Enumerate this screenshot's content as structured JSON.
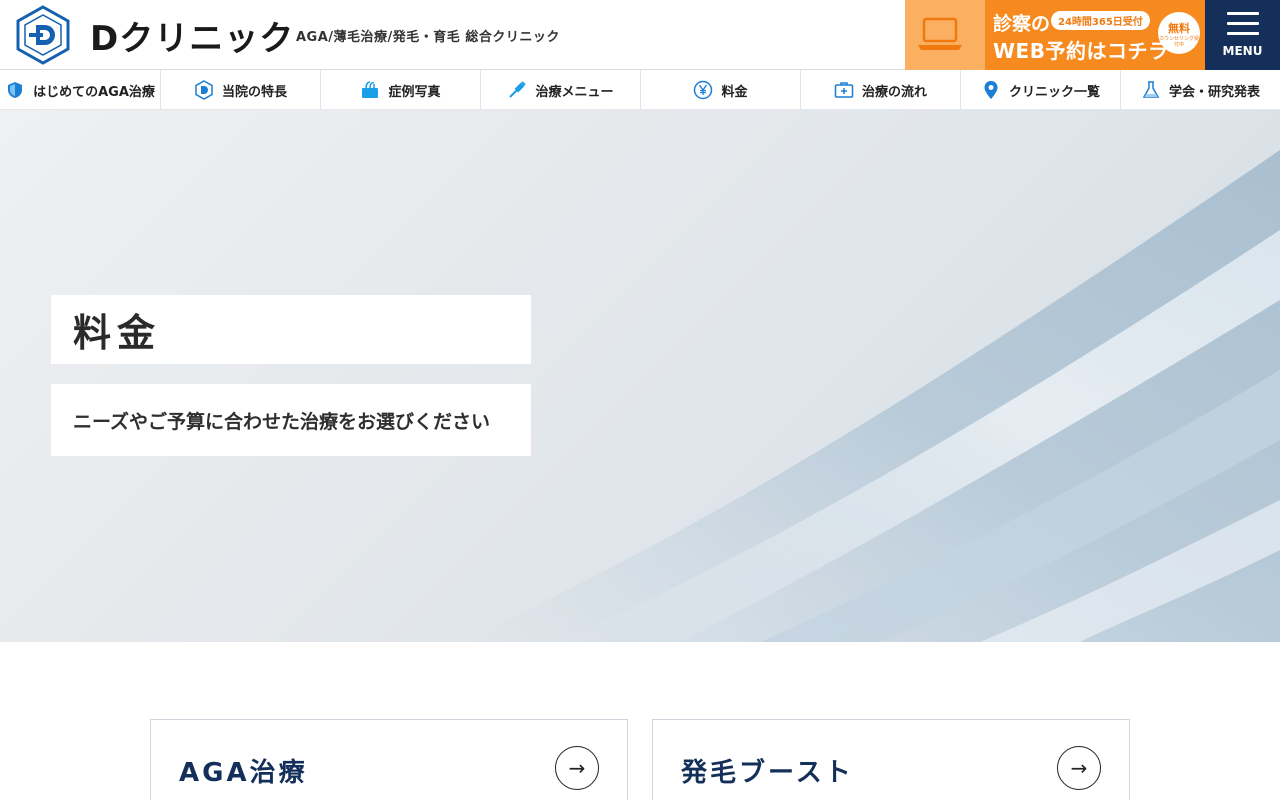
{
  "header": {
    "logo_text": "Dクリニック",
    "logo_icon": "d-hexagon-logo-icon",
    "tagline": "AGA/薄毛治療/発毛・育毛 総合クリニック",
    "web_banner": {
      "line1": "診察の",
      "pill": "24時間365日受付",
      "line2": "WEB予約はコチラ",
      "free_big": "無料",
      "free_small": "カウンセリング受付中",
      "icon": "laptop-icon",
      "color": "#f78a1e"
    },
    "menu_label": "MENU",
    "menu_color": "#14305a"
  },
  "nav": {
    "items": [
      {
        "label": "はじめてのAGA治療",
        "icon": "shield-icon"
      },
      {
        "label": "当院の特長",
        "icon": "d-logo-icon"
      },
      {
        "label": "症例写真",
        "icon": "hair-icon"
      },
      {
        "label": "治療メニュー",
        "icon": "syringe-icon"
      },
      {
        "label": "料金",
        "icon": "yen-icon"
      },
      {
        "label": "治療の流れ",
        "icon": "medical-kit-icon"
      },
      {
        "label": "クリニック一覧",
        "icon": "map-pin-icon"
      },
      {
        "label": "学会・研究発表",
        "icon": "flask-icon"
      }
    ]
  },
  "hero": {
    "title": "料金",
    "subtitle": "ニーズやご予算に合わせた治療をお選びください"
  },
  "cards": [
    {
      "title": "AGA治療",
      "arrow": "→"
    },
    {
      "title": "発毛ブースト",
      "arrow": "→"
    }
  ]
}
